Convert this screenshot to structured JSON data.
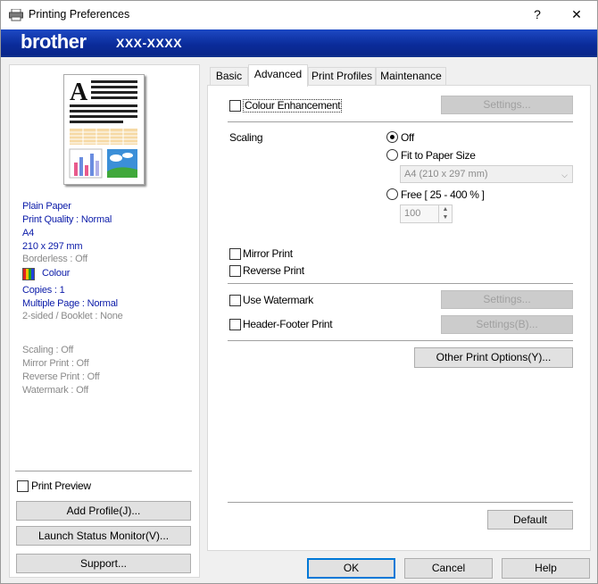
{
  "window": {
    "title": "Printing Preferences",
    "help_glyph": "?",
    "close_glyph": "✕"
  },
  "banner": {
    "brand": "brother",
    "model": "XXX-XXXX"
  },
  "summary": {
    "media": "Plain Paper",
    "quality": "Print Quality : Normal",
    "size": "A4",
    "dimensions": "210 x 297 mm",
    "borderless": "Borderless : Off",
    "colour": "Colour",
    "copies": "Copies : 1",
    "multiple_page": "Multiple Page : Normal",
    "two_sided": "2-sided / Booklet : None",
    "scaling": "Scaling : Off",
    "mirror": "Mirror Print : Off",
    "reverse": "Reverse Print : Off",
    "watermark": "Watermark : Off"
  },
  "left_controls": {
    "print_preview": "Print Preview",
    "add_profile": "Add Profile(J)...",
    "launch_status": "Launch Status Monitor(V)...",
    "support": "Support..."
  },
  "tabs": [
    "Basic",
    "Advanced",
    "Print Profiles",
    "Maintenance"
  ],
  "advanced": {
    "colour_enhancement": "Colour Enhancement",
    "settings_1": "Settings...",
    "scaling_label": "Scaling",
    "off": "Off",
    "fit_to_paper": "Fit to Paper Size",
    "paper_select": "A4 (210 x 297 mm)",
    "free": "Free [ 25 - 400 % ]",
    "free_value": "100",
    "mirror_print": "Mirror Print",
    "reverse_print": "Reverse Print",
    "use_watermark": "Use Watermark",
    "settings_2": "Settings...",
    "header_footer": "Header-Footer Print",
    "settings_3": "Settings(B)...",
    "other_options": "Other Print Options(Y)...",
    "default_btn": "Default"
  },
  "footer": {
    "ok": "OK",
    "cancel": "Cancel",
    "help": "Help"
  },
  "colors": {
    "banner": "#0a2ea0",
    "focus": "#0078d7",
    "summary_text": "#0a1aa8"
  }
}
